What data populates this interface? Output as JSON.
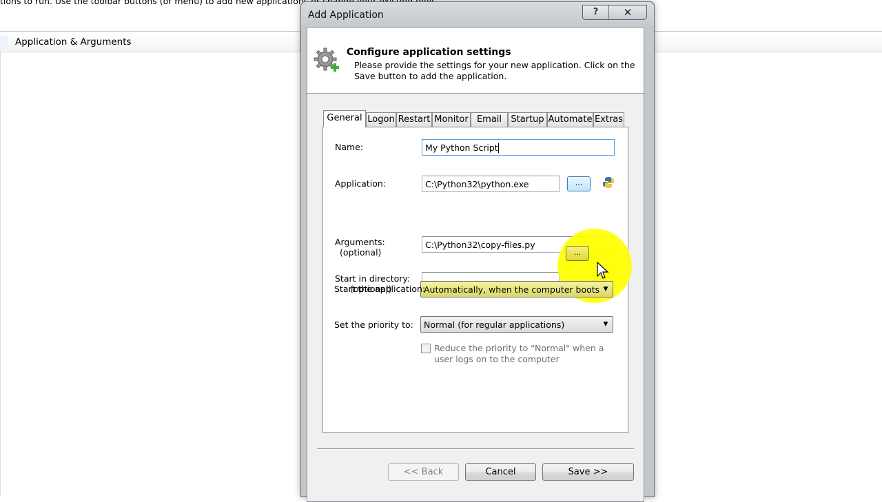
{
  "background": {
    "hint": "tions to run. Use the toolbar buttons (or menu) to add new applications or change your existing ones",
    "column_header": "Application & Arguments"
  },
  "dialog": {
    "title": "Add Application",
    "help_label": "?",
    "close_label": "✕",
    "header": {
      "title": "Configure application settings",
      "description": "Please provide the settings for your new application. Click on the Save button to add the application."
    },
    "tabs": [
      "General",
      "Logon",
      "Restart",
      "Monitor",
      "Email",
      "Startup",
      "Automate",
      "Extras"
    ],
    "active_tab": "General",
    "fields": {
      "name_label": "Name:",
      "name_value": "My Python Script",
      "application_label": "Application:",
      "application_value": "C:\\Python32\\python.exe",
      "arguments_label": "Arguments:",
      "arguments_optional": "(optional)",
      "arguments_value": "C:\\Python32\\copy-files.py",
      "start_dir_label": "Start in directory:",
      "start_dir_optional": "(optional)",
      "start_dir_value": "",
      "browse_label": "...",
      "start_app_label": "Start the application:",
      "start_app_value": "Automatically, when the computer boots",
      "priority_label": "Set the priority to:",
      "priority_value": "Normal (for regular applications)",
      "reduce_priority_label": "Reduce the priority to \"Normal\" when a user logs on to the computer"
    },
    "buttons": {
      "back": "<< Back",
      "cancel": "Cancel",
      "save": "Save >>"
    },
    "colors": {
      "highlight": "#ffff00",
      "titlebar": "#c4c8ce"
    }
  }
}
